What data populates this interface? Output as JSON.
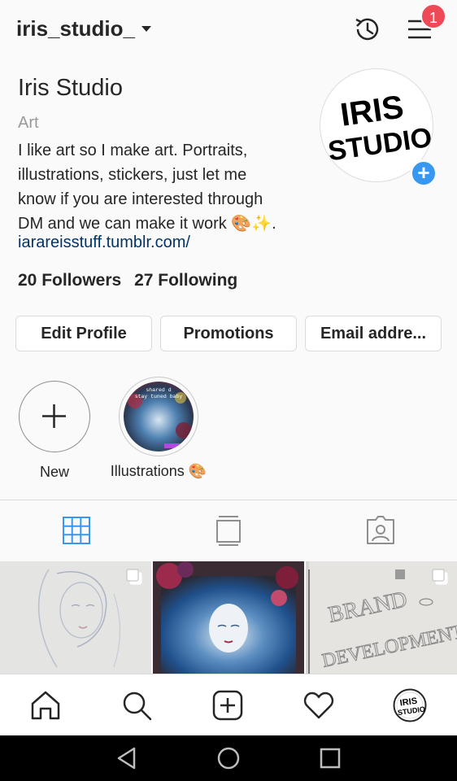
{
  "header": {
    "username": "iris_studio_",
    "notification_count": "1",
    "icons": [
      "chevron-down-icon",
      "history-icon",
      "menu-icon"
    ]
  },
  "profile": {
    "display_name": "Iris Studio",
    "category": "Art",
    "bio_line1": "I like art so I make art. Portraits,",
    "bio_line2": "illustrations, stickers, just let me",
    "bio_line3": "know if you are interested through",
    "bio_line4": "DM and we can make it work 🎨✨.",
    "link": "iarareisstuff.tumblr.com/",
    "avatar_text_line1": "IRIS",
    "avatar_text_line2": "STUDIO",
    "followers": "20 Followers",
    "following": "27 Following"
  },
  "buttons": {
    "edit_profile": "Edit Profile",
    "promotions": "Promotions",
    "email": "Email addre..."
  },
  "highlights": [
    {
      "label": "New",
      "icon": "plus-icon"
    },
    {
      "label": "Illustrations 🎨",
      "overlay_line1": "shared d",
      "overlay_line2": "stay tuned baby"
    }
  ],
  "tabs": [
    {
      "name": "grid",
      "icon": "grid-icon",
      "active": true
    },
    {
      "name": "feed",
      "icon": "feed-icon",
      "active": false
    },
    {
      "name": "tagged",
      "icon": "tagged-icon",
      "active": false
    }
  ],
  "posts": [
    {
      "caption": "",
      "multi": true
    },
    {
      "caption": "",
      "multi": false
    },
    {
      "caption_line1": "BRAND",
      "caption_line2": "DEVELOPMENT",
      "multi": true
    }
  ],
  "nav": [
    "home-icon",
    "search-icon",
    "add-post-icon",
    "activity-icon",
    "profile-icon"
  ],
  "system_nav": [
    "back-icon",
    "home-circle-icon",
    "recents-icon"
  ],
  "colors": {
    "accent_blue": "#3897f0",
    "badge_red": "#ed4956",
    "link_blue": "#003569",
    "text": "#262626",
    "muted": "#999999"
  }
}
